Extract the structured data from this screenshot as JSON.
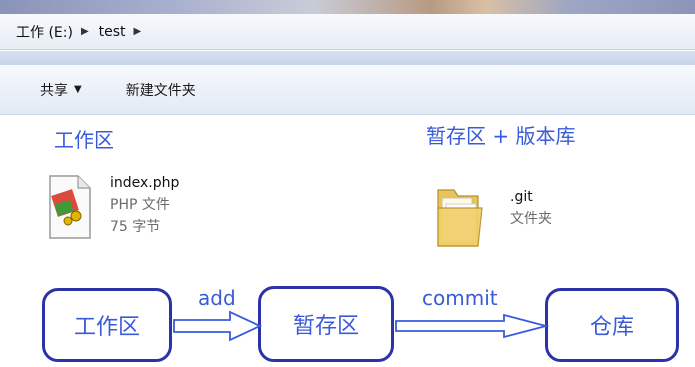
{
  "address_bar": {
    "crumbs": [
      "工作 (E:)",
      "test"
    ]
  },
  "toolbar": {
    "share_label": "共享",
    "new_folder_label": "新建文件夹"
  },
  "annotations": {
    "workspace_title": "工作区",
    "staging_repo_title": "暂存区 + 版本库"
  },
  "files": [
    {
      "name": "index.php",
      "type": "PHP 文件",
      "size": "75 字节",
      "icon": "php-file-icon"
    },
    {
      "name": ".git",
      "type": "文件夹",
      "icon": "folder-icon"
    }
  ],
  "diagram": {
    "boxes": [
      "工作区",
      "暂存区",
      "仓库"
    ],
    "arrows": [
      "add",
      "commit"
    ]
  },
  "colors": {
    "annotation_blue": "#3a5bd9",
    "box_border": "#2c33a6"
  }
}
